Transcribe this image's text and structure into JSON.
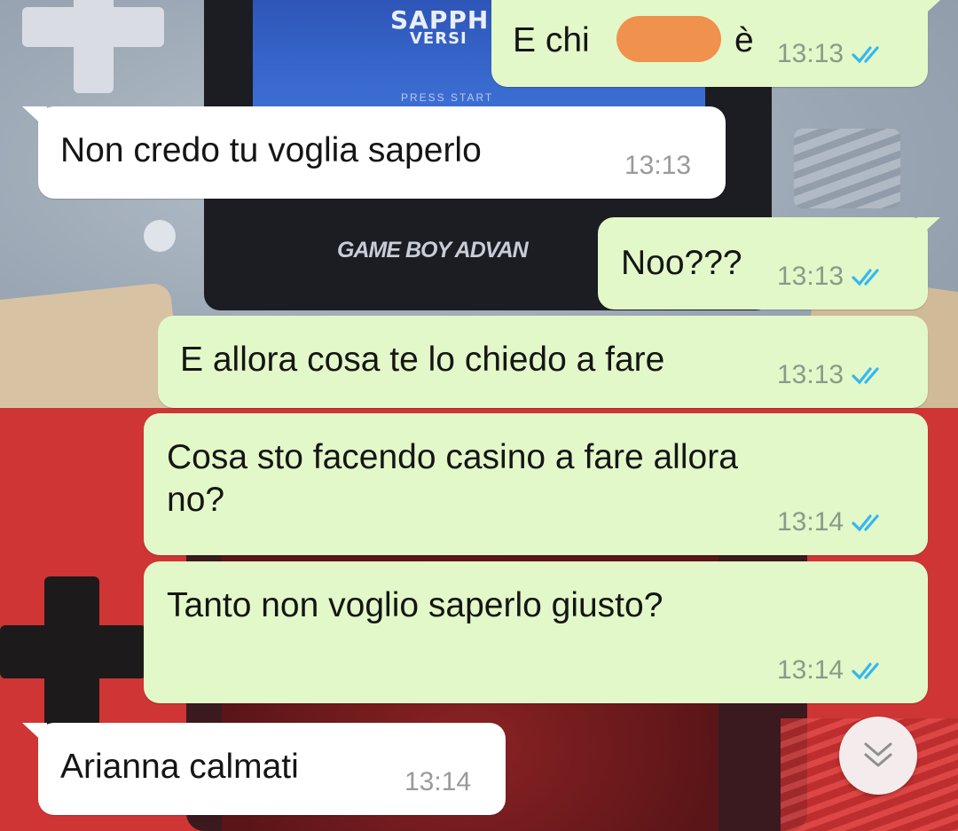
{
  "wallpaper": {
    "game_title": "SAPPH",
    "game_subtitle": "VERSI",
    "press_start": "PRESS START",
    "brand": "GAME BOY ADVAN"
  },
  "messages": [
    {
      "id": "m1",
      "direction": "outgoing",
      "text": "E chi",
      "text_suffix": "è",
      "time": "13:13",
      "status": "read",
      "redacted": true
    },
    {
      "id": "m2",
      "direction": "incoming",
      "text": "Non credo tu voglia saperlo",
      "time": "13:13"
    },
    {
      "id": "m3",
      "direction": "outgoing",
      "text": "Noo???",
      "time": "13:13",
      "status": "read"
    },
    {
      "id": "m4",
      "direction": "outgoing",
      "text": "E allora cosa te lo chiedo a fare",
      "time": "13:13",
      "status": "read"
    },
    {
      "id": "m5",
      "direction": "outgoing",
      "text": "Cosa sto facendo casino a fare allora\nno?",
      "time": "13:14",
      "status": "read"
    },
    {
      "id": "m6",
      "direction": "outgoing",
      "text": "Tanto non voglio saperlo giusto?",
      "time": "13:14",
      "status": "read"
    },
    {
      "id": "m7",
      "direction": "incoming",
      "text": "Arianna calmati",
      "time": "13:14"
    }
  ],
  "colors": {
    "outgoing_bubble": "#e2f8c8",
    "incoming_bubble": "#ffffff",
    "read_ticks": "#34b7f1",
    "redaction": "#f0914e"
  },
  "icons": {
    "read_status": "double-check-icon",
    "scroll_down": "double-chevron-down-icon"
  }
}
